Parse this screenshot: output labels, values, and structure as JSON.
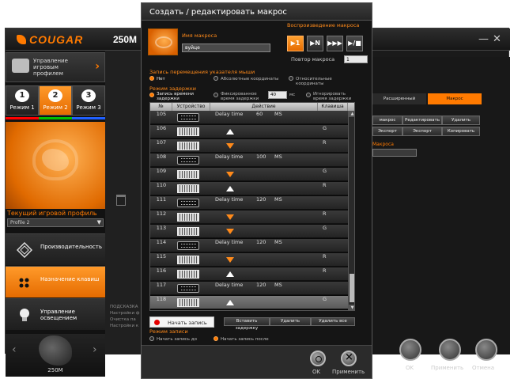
{
  "bg_app": {
    "brand": "COUGAR",
    "model": "250M",
    "win_min": "—",
    "win_close": "✕",
    "profile_mgmt": "Управление игровым профилем",
    "modes": [
      {
        "num": "1",
        "label": "Режим 1"
      },
      {
        "num": "2",
        "label": "Режим 2"
      },
      {
        "num": "3",
        "label": "Режим 3"
      }
    ],
    "mode_colors": [
      "#ff0000",
      "#00c000",
      "#2060ff"
    ],
    "current_profile_label": "Текущий игровой профиль",
    "profile_value": "Profile 2",
    "side_buttons": [
      {
        "label": "Производительность",
        "icon": "performance-icon"
      },
      {
        "label": "Назначение клавиш",
        "icon": "key-assign-icon"
      },
      {
        "label": "Управление освещением",
        "icon": "bulb-icon"
      }
    ],
    "mouse_model": "250M",
    "info_lines": [
      "ПОДСКАЗКА",
      "Настройки ф",
      "Очистка па",
      "Настройки к"
    ],
    "right": {
      "tab_advanced": "Расширенный",
      "tab_macro": "Макрос",
      "btn_row1": [
        "макрос",
        "Редактировать",
        "Удалить"
      ],
      "btn_row2": [
        "Экспорт",
        "Экспорт",
        "Копировать"
      ],
      "macro_label": "Макросa"
    },
    "bottom_buttons": [
      "OK",
      "Применить",
      "Отмена"
    ]
  },
  "dialog": {
    "title": "Создать / редактировать макрос",
    "macro_name_label": "Имя макроса",
    "macro_name_value": "вуйце",
    "playback_label": "Воспроизведение макроса",
    "playback_buttons": [
      "▶1",
      "▶N",
      "▶▶▶",
      "▶/■"
    ],
    "repeat_label": "Повтор макроса",
    "repeat_value": "1",
    "pointer_label": "Запись перемещения указателя мыши",
    "pointer_options": [
      "Нет",
      "Абсолютные координаты",
      "Относительные координаты"
    ],
    "delay_mode_label": "Режим задержки",
    "delay_options": [
      "Запись времени задержки",
      "Фиксированное время задержки",
      "Игнорировать время задержки"
    ],
    "fixed_delay_value": "40",
    "fixed_delay_unit": "мс",
    "columns": [
      "№",
      "Устройство",
      "Действие",
      "Клавиша"
    ],
    "rows": [
      {
        "num": "105",
        "dev": "clock",
        "action": "Delay time",
        "dval": "60",
        "dunit": "MS",
        "arrow": "",
        "key": ""
      },
      {
        "num": "106",
        "dev": "kbd",
        "action": "",
        "dval": "",
        "dunit": "",
        "arrow": "up",
        "key": "G"
      },
      {
        "num": "107",
        "dev": "kbd",
        "action": "",
        "dval": "",
        "dunit": "",
        "arrow": "down",
        "key": "R"
      },
      {
        "num": "108",
        "dev": "clock",
        "action": "Delay time",
        "dval": "100",
        "dunit": "MS",
        "arrow": "",
        "key": ""
      },
      {
        "num": "109",
        "dev": "kbd",
        "action": "",
        "dval": "",
        "dunit": "",
        "arrow": "down",
        "key": "G"
      },
      {
        "num": "110",
        "dev": "kbd",
        "action": "",
        "dval": "",
        "dunit": "",
        "arrow": "up",
        "key": "R"
      },
      {
        "num": "111",
        "dev": "clock",
        "action": "Delay time",
        "dval": "120",
        "dunit": "MS",
        "arrow": "",
        "key": ""
      },
      {
        "num": "112",
        "dev": "kbd",
        "action": "",
        "dval": "",
        "dunit": "",
        "arrow": "down",
        "key": "R"
      },
      {
        "num": "113",
        "dev": "kbd",
        "action": "",
        "dval": "",
        "dunit": "",
        "arrow": "down",
        "key": "G"
      },
      {
        "num": "114",
        "dev": "clock",
        "action": "Delay time",
        "dval": "120",
        "dunit": "MS",
        "arrow": "",
        "key": ""
      },
      {
        "num": "115",
        "dev": "kbd",
        "action": "",
        "dval": "",
        "dunit": "",
        "arrow": "down",
        "key": "R"
      },
      {
        "num": "116",
        "dev": "kbd",
        "action": "",
        "dval": "",
        "dunit": "",
        "arrow": "up",
        "key": "R"
      },
      {
        "num": "117",
        "dev": "clock",
        "action": "Delay time",
        "dval": "120",
        "dunit": "MS",
        "arrow": "",
        "key": ""
      },
      {
        "num": "118",
        "dev": "kbd",
        "action": "",
        "dval": "",
        "dunit": "",
        "arrow": "up",
        "key": "G"
      }
    ],
    "selected_row": "118",
    "start_record": "Начать запись",
    "insert_delay": "Вставить задержку",
    "delete": "Удалить",
    "delete_all": "Удалить все",
    "rec_mode_label": "Режим записи",
    "rec_options": [
      "Начать запись до",
      "Начать запись после"
    ],
    "ok": "OK",
    "apply": "Применить"
  }
}
